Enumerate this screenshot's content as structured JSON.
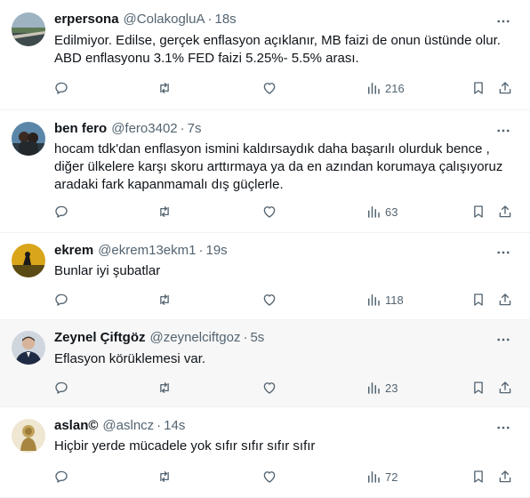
{
  "colors": {
    "icon": "#536471",
    "text": "#0f1419",
    "secondary": "#536471",
    "divider": "#eff3f4"
  },
  "tweets": [
    {
      "name": "erpersona",
      "handle": "@ColakogluA",
      "separator": "·",
      "time": "18s",
      "lines": [
        "Edilmiyor.  Edilse, gerçek enflasyon açıklanır, MB faizi de onun üstünde olur.",
        "ABD enflasyonu 3.1% FED faizi 5.25%- 5.5% arası."
      ],
      "views": "216",
      "avatar": "landscape"
    },
    {
      "name": "ben fero",
      "handle": "@fero3402",
      "separator": "·",
      "time": "7s",
      "lines": [
        "hocam tdk'dan enflasyon ismini kaldırsaydık daha başarılı olurduk bence ,",
        "diğer ülkelere karşı skoru arttırmaya ya da en azından korumaya çalışıyoruz",
        "aradaki fark kapanmamalı dış güçlerle."
      ],
      "views": "63",
      "avatar": "couple"
    },
    {
      "name": "ekrem",
      "handle": "@ekrem13ekm1",
      "separator": "·",
      "time": "19s",
      "lines": [
        "Bunlar iyi şubatlar"
      ],
      "views": "118",
      "avatar": "sunset"
    },
    {
      "name": "Zeynel Çiftgöz",
      "handle": "@zeynelciftgoz",
      "separator": "·",
      "time": "5s",
      "lines": [
        "Eflasyon körüklemesi var."
      ],
      "views": "23",
      "avatar": "man"
    },
    {
      "name": "aslan©",
      "handle": "@aslncz",
      "separator": "·",
      "time": "14s",
      "lines": [
        "Hiçbir yerde mücadele yok sıfır sıfır sıfır sıfır"
      ],
      "views": "72",
      "avatar": "statue"
    }
  ]
}
